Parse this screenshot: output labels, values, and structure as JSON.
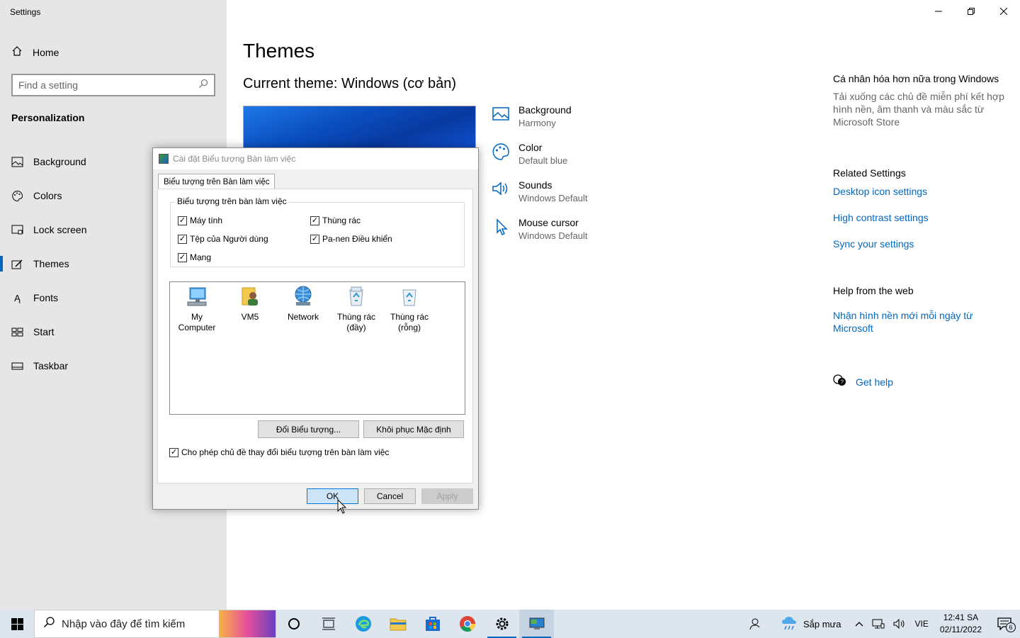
{
  "app": {
    "title": "Settings"
  },
  "sidebar": {
    "home_label": "Home",
    "search_placeholder": "Find a setting",
    "section_title": "Personalization",
    "items": [
      {
        "label": "Background",
        "icon": "image-icon"
      },
      {
        "label": "Colors",
        "icon": "palette-icon"
      },
      {
        "label": "Lock screen",
        "icon": "lock-screen-icon"
      },
      {
        "label": "Themes",
        "icon": "themes-icon",
        "active": true
      },
      {
        "label": "Fonts",
        "icon": "fonts-icon"
      },
      {
        "label": "Start",
        "icon": "start-icon"
      },
      {
        "label": "Taskbar",
        "icon": "taskbar-icon"
      }
    ]
  },
  "main": {
    "title": "Themes",
    "current_theme": "Current theme: Windows (cơ bản)",
    "options": [
      {
        "label": "Background",
        "value": "Harmony"
      },
      {
        "label": "Color",
        "value": "Default blue"
      },
      {
        "label": "Sounds",
        "value": "Windows Default"
      },
      {
        "label": "Mouse cursor",
        "value": "Windows Default"
      }
    ]
  },
  "right": {
    "more_heading": "Cá nhân hóa hơn nữa trong Windows",
    "more_text": "Tải xuống các chủ đề miễn phí kết hợp hình nền, âm thanh và màu sắc từ Microsoft Store",
    "related_heading": "Related Settings",
    "related_links": [
      "Desktop icon settings",
      "High contrast settings",
      "Sync your settings"
    ],
    "help_heading": "Help from the web",
    "help_link": "Nhận hình nền mới mỗi ngày từ Microsoft",
    "get_help": "Get help"
  },
  "dialog": {
    "title": "Cài đặt Biểu tượng Bàn làm việc",
    "tab": "Biểu tượng trên Bàn làm việc",
    "group_title": "Biểu tượng trên bàn làm việc",
    "checkboxes": {
      "computer": "Máy tính",
      "recycle": "Thùng rác",
      "user_files": "Tệp của Người dùng",
      "control_panel": "Pa-nen Điều khiển",
      "network": "Mạng"
    },
    "icons": {
      "my_computer": "My Computer",
      "user": "VM5",
      "network": "Network",
      "recycle_full": "Thùng rác (đầy)",
      "recycle_empty": "Thùng rác (rỗng)"
    },
    "change_icon_button": "Đổi Biểu tượng...",
    "restore_default_button": "Khôi phục Mặc định",
    "allow_themes": "Cho phép chủ đề thay đổi biểu tượng trên bàn làm việc",
    "ok": "OK",
    "cancel": "Cancel",
    "apply": "Apply"
  },
  "taskbar": {
    "search_placeholder": "Nhập vào đây để tìm kiếm",
    "weather": "Sắp mưa",
    "language": "VIE",
    "time": "12:41 SA",
    "date": "02/11/2022",
    "notification_count": "6"
  },
  "colors": {
    "accent": "#0067c0",
    "sidebar_bg": "#e6e6e6",
    "taskbar_bg": "#dde6ee"
  }
}
